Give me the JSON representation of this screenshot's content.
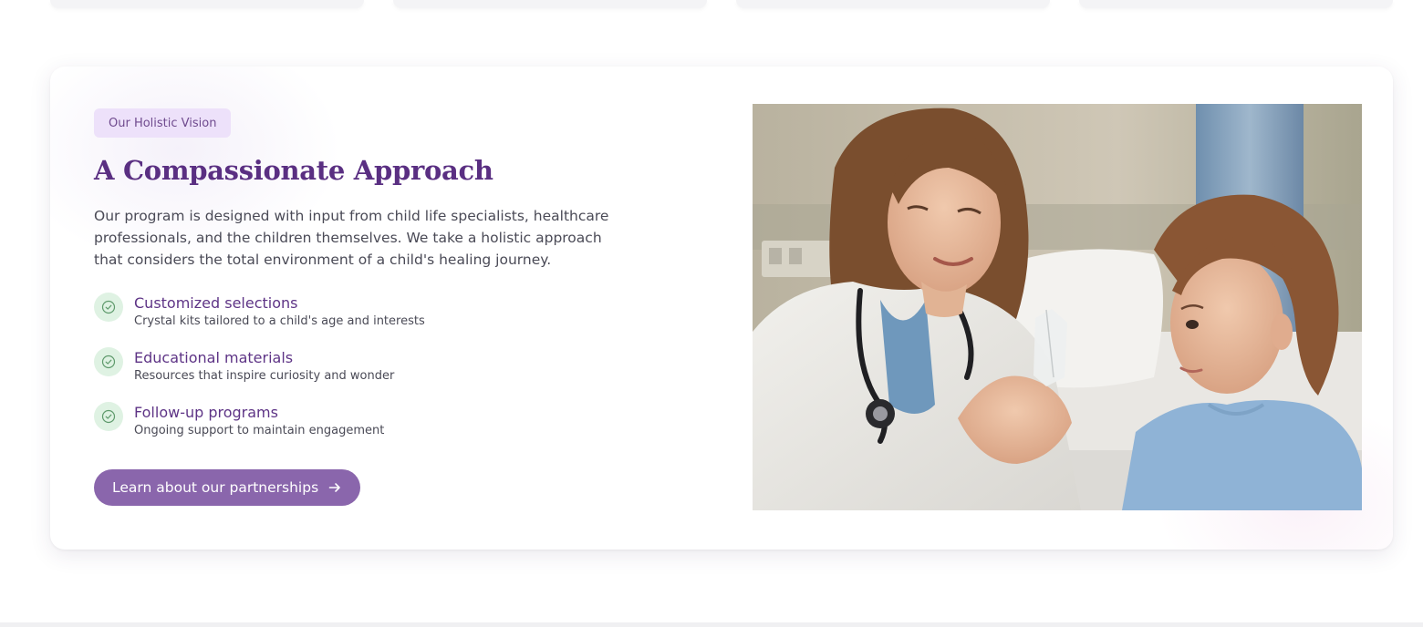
{
  "section": {
    "badge": "Our Holistic Vision",
    "title": "A Compassionate Approach",
    "description": "Our program is designed with input from child life specialists, healthcare professionals, and the children themselves. We take a holistic approach that considers the total environment of a child's healing journey.",
    "features": [
      {
        "title": "Customized selections",
        "subtitle": "Crystal kits tailored to a child's age and interests",
        "icon": "check-circle-icon"
      },
      {
        "title": "Educational materials",
        "subtitle": "Resources that inspire curiosity and wonder",
        "icon": "check-circle-icon"
      },
      {
        "title": "Follow-up programs",
        "subtitle": "Ongoing support to maintain engagement",
        "icon": "check-circle-icon"
      }
    ],
    "cta_label": "Learn about our partnerships",
    "cta_icon": "arrow-right-icon",
    "image": {
      "subject": "doctor-showing-crystal-to-child"
    }
  },
  "colors": {
    "accent": "#5a2f82",
    "button": "#8a66ac",
    "badge_bg": "#ede1fa",
    "check_bg": "#dff2e3",
    "check_stroke": "#5f9a6c"
  }
}
